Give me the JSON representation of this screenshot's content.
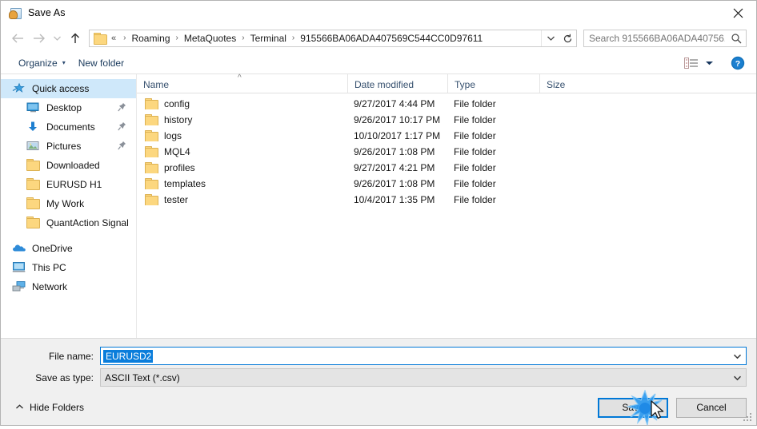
{
  "window": {
    "title": "Save As",
    "icon": "save-as-icon",
    "close_label": "✕"
  },
  "nav": {
    "back": "back-arrow",
    "forward": "forward-arrow",
    "recent": "recent-locations-chevron",
    "up": "up-arrow",
    "refresh": "refresh-icon",
    "address_chevron": "chevron-down-icon"
  },
  "address": {
    "lead": "«",
    "crumbs": [
      "Roaming",
      "MetaQuotes",
      "Terminal",
      "915566BA06ADA407569C544CC0D97611"
    ],
    "separator": "›"
  },
  "search": {
    "placeholder": "Search 915566BA06ADA40756...",
    "value": "",
    "icon": "search-icon"
  },
  "toolbar": {
    "organize_label": "Organize",
    "organize_caret": "▾",
    "new_folder_label": "New folder",
    "view_icon": "view-options-icon",
    "view_caret": "▾",
    "help_label": "?"
  },
  "sidebar": {
    "items": [
      {
        "label": "Quick access",
        "icon": "star-icon",
        "level": 1,
        "selected": true,
        "pinned": false
      },
      {
        "label": "Desktop",
        "icon": "desktop-icon",
        "level": 2,
        "selected": false,
        "pinned": true
      },
      {
        "label": "Documents",
        "icon": "documents-download-icon",
        "level": 2,
        "selected": false,
        "pinned": true
      },
      {
        "label": "Pictures",
        "icon": "pictures-icon",
        "level": 2,
        "selected": false,
        "pinned": true
      },
      {
        "label": "Downloaded",
        "icon": "folder-icon",
        "level": 2,
        "selected": false,
        "pinned": false
      },
      {
        "label": "EURUSD H1",
        "icon": "folder-icon",
        "level": 2,
        "selected": false,
        "pinned": false
      },
      {
        "label": "My Work",
        "icon": "folder-icon",
        "level": 2,
        "selected": false,
        "pinned": false
      },
      {
        "label": "QuantAction Signal",
        "icon": "folder-icon",
        "level": 2,
        "selected": false,
        "pinned": false
      },
      {
        "label": "OneDrive",
        "icon": "onedrive-icon",
        "level": 1,
        "selected": false,
        "pinned": false
      },
      {
        "label": "This PC",
        "icon": "this-pc-icon",
        "level": 1,
        "selected": false,
        "pinned": false
      },
      {
        "label": "Network",
        "icon": "network-icon",
        "level": 1,
        "selected": false,
        "pinned": false
      }
    ]
  },
  "filelist": {
    "columns": [
      "Name",
      "Date modified",
      "Type",
      "Size"
    ],
    "sort": {
      "column": "Name",
      "direction": "ascending",
      "glyph": "^"
    },
    "rows": [
      {
        "name": "config",
        "date": "9/27/2017 4:44 PM",
        "type": "File folder",
        "size": ""
      },
      {
        "name": "history",
        "date": "9/26/2017 10:17 PM",
        "type": "File folder",
        "size": ""
      },
      {
        "name": "logs",
        "date": "10/10/2017 1:17 PM",
        "type": "File folder",
        "size": ""
      },
      {
        "name": "MQL4",
        "date": "9/26/2017 1:08 PM",
        "type": "File folder",
        "size": ""
      },
      {
        "name": "profiles",
        "date": "9/27/2017 4:21 PM",
        "type": "File folder",
        "size": ""
      },
      {
        "name": "templates",
        "date": "9/26/2017 1:08 PM",
        "type": "File folder",
        "size": ""
      },
      {
        "name": "tester",
        "date": "10/4/2017 1:35 PM",
        "type": "File folder",
        "size": ""
      }
    ]
  },
  "form": {
    "filename_label": "File name:",
    "filename_value": "EURUSD2",
    "filetype_label": "Save as type:",
    "filetype_value": "ASCII Text (*.csv)",
    "dropdown_icon": "chevron-down-icon"
  },
  "footer": {
    "hide_folders_label": "Hide Folders",
    "hide_folders_caret": "^",
    "save_label": "Save",
    "cancel_label": "Cancel",
    "resize_grip": "resize-grip"
  },
  "colors": {
    "accent": "#0078d7",
    "selection": "#cfe8fa",
    "text_selection": "#0a7ddb",
    "folder": "#fcd77f",
    "header_text": "#36506e",
    "chrome": "#f0f0f0"
  }
}
